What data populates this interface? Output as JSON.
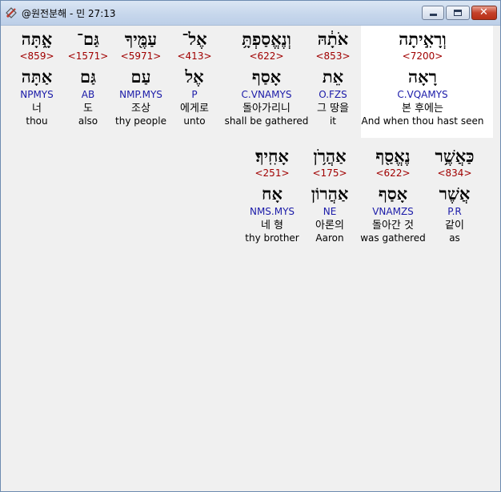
{
  "window": {
    "title": "@원전분해 - 민 27:13",
    "buttons": {
      "minimize": "minimize",
      "maximize": "maximize",
      "close": "✕"
    }
  },
  "rows": [
    {
      "words": [
        {
          "hebrew": "וְרָאִ֣יתָה",
          "strong": "<7200>",
          "root": "רָאָה",
          "morph": "C.VQAMYS",
          "korean": "본 후에는",
          "english": "And when thou hast seen",
          "highlighted": true
        },
        {
          "hebrew": "אֹתָ֔הּ",
          "strong": "<853>",
          "root": "אֵת",
          "morph": "O.FZS",
          "korean": "그 땅을",
          "english": "it"
        },
        {
          "hebrew": "וְנֶאֱסַפְתָּ֥",
          "strong": "<622>",
          "root": "אָסַף",
          "morph": "C.VNAMYS",
          "korean": "돌아가리니",
          "english": "shall be gathered"
        },
        {
          "hebrew": "אֶל־",
          "strong": "<413>",
          "root": "אֶל",
          "morph": "P",
          "korean": "에게로",
          "english": "unto"
        },
        {
          "hebrew": "עַמֶּ֖יךָ",
          "strong": "<5971>",
          "root": "עַם",
          "morph": "NMP.MYS",
          "korean": "조상",
          "english": "thy people"
        },
        {
          "hebrew": "גַּם־",
          "strong": "<1571>",
          "root": "גַּם",
          "morph": "AB",
          "korean": "도",
          "english": "also"
        },
        {
          "hebrew": "אָ֑תָּה",
          "strong": "<859>",
          "root": "אַתָּה",
          "morph": "NPMYS",
          "korean": "너",
          "english": "thou"
        }
      ]
    },
    {
      "words": [
        {
          "hebrew": "כַּאֲשֶׁ֥ר",
          "strong": "<834>",
          "root": "אֲשֶׁר",
          "morph": "P.R",
          "korean": "같이",
          "english": "as"
        },
        {
          "hebrew": "נֶאֱסַ֖ף",
          "strong": "<622>",
          "root": "אָסַף",
          "morph": "VNAMZS",
          "korean": "돌아간 것",
          "english": "was gathered"
        },
        {
          "hebrew": "אַהֲרֹ֥ן",
          "strong": "<175>",
          "root": "אַהֲרוֹן",
          "morph": "NE",
          "korean": "아론의",
          "english": "Aaron"
        },
        {
          "hebrew": "אָחִֽיךָ׃",
          "strong": "<251>",
          "root": "אָח",
          "morph": "NMS.MYS",
          "korean": "네 형",
          "english": "thy brother"
        }
      ]
    }
  ],
  "colors": {
    "strong": "#a00000",
    "morph": "#1a1aa8",
    "highlight": "#ffffff",
    "background": "#f0f0f0"
  },
  "icons": {
    "app": "dictionary-app-icon"
  }
}
